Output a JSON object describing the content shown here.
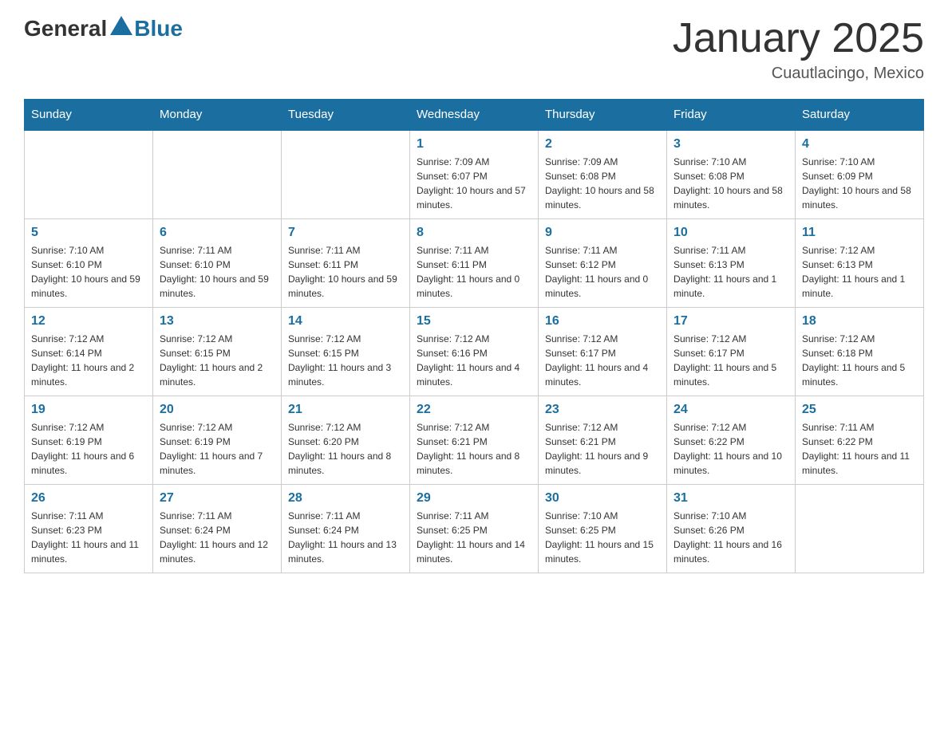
{
  "header": {
    "logo_general": "General",
    "logo_blue": "Blue",
    "month_title": "January 2025",
    "location": "Cuautlacingo, Mexico"
  },
  "weekdays": [
    "Sunday",
    "Monday",
    "Tuesday",
    "Wednesday",
    "Thursday",
    "Friday",
    "Saturday"
  ],
  "weeks": [
    [
      {
        "day": "",
        "info": ""
      },
      {
        "day": "",
        "info": ""
      },
      {
        "day": "",
        "info": ""
      },
      {
        "day": "1",
        "info": "Sunrise: 7:09 AM\nSunset: 6:07 PM\nDaylight: 10 hours and 57 minutes."
      },
      {
        "day": "2",
        "info": "Sunrise: 7:09 AM\nSunset: 6:08 PM\nDaylight: 10 hours and 58 minutes."
      },
      {
        "day": "3",
        "info": "Sunrise: 7:10 AM\nSunset: 6:08 PM\nDaylight: 10 hours and 58 minutes."
      },
      {
        "day": "4",
        "info": "Sunrise: 7:10 AM\nSunset: 6:09 PM\nDaylight: 10 hours and 58 minutes."
      }
    ],
    [
      {
        "day": "5",
        "info": "Sunrise: 7:10 AM\nSunset: 6:10 PM\nDaylight: 10 hours and 59 minutes."
      },
      {
        "day": "6",
        "info": "Sunrise: 7:11 AM\nSunset: 6:10 PM\nDaylight: 10 hours and 59 minutes."
      },
      {
        "day": "7",
        "info": "Sunrise: 7:11 AM\nSunset: 6:11 PM\nDaylight: 10 hours and 59 minutes."
      },
      {
        "day": "8",
        "info": "Sunrise: 7:11 AM\nSunset: 6:11 PM\nDaylight: 11 hours and 0 minutes."
      },
      {
        "day": "9",
        "info": "Sunrise: 7:11 AM\nSunset: 6:12 PM\nDaylight: 11 hours and 0 minutes."
      },
      {
        "day": "10",
        "info": "Sunrise: 7:11 AM\nSunset: 6:13 PM\nDaylight: 11 hours and 1 minute."
      },
      {
        "day": "11",
        "info": "Sunrise: 7:12 AM\nSunset: 6:13 PM\nDaylight: 11 hours and 1 minute."
      }
    ],
    [
      {
        "day": "12",
        "info": "Sunrise: 7:12 AM\nSunset: 6:14 PM\nDaylight: 11 hours and 2 minutes."
      },
      {
        "day": "13",
        "info": "Sunrise: 7:12 AM\nSunset: 6:15 PM\nDaylight: 11 hours and 2 minutes."
      },
      {
        "day": "14",
        "info": "Sunrise: 7:12 AM\nSunset: 6:15 PM\nDaylight: 11 hours and 3 minutes."
      },
      {
        "day": "15",
        "info": "Sunrise: 7:12 AM\nSunset: 6:16 PM\nDaylight: 11 hours and 4 minutes."
      },
      {
        "day": "16",
        "info": "Sunrise: 7:12 AM\nSunset: 6:17 PM\nDaylight: 11 hours and 4 minutes."
      },
      {
        "day": "17",
        "info": "Sunrise: 7:12 AM\nSunset: 6:17 PM\nDaylight: 11 hours and 5 minutes."
      },
      {
        "day": "18",
        "info": "Sunrise: 7:12 AM\nSunset: 6:18 PM\nDaylight: 11 hours and 5 minutes."
      }
    ],
    [
      {
        "day": "19",
        "info": "Sunrise: 7:12 AM\nSunset: 6:19 PM\nDaylight: 11 hours and 6 minutes."
      },
      {
        "day": "20",
        "info": "Sunrise: 7:12 AM\nSunset: 6:19 PM\nDaylight: 11 hours and 7 minutes."
      },
      {
        "day": "21",
        "info": "Sunrise: 7:12 AM\nSunset: 6:20 PM\nDaylight: 11 hours and 8 minutes."
      },
      {
        "day": "22",
        "info": "Sunrise: 7:12 AM\nSunset: 6:21 PM\nDaylight: 11 hours and 8 minutes."
      },
      {
        "day": "23",
        "info": "Sunrise: 7:12 AM\nSunset: 6:21 PM\nDaylight: 11 hours and 9 minutes."
      },
      {
        "day": "24",
        "info": "Sunrise: 7:12 AM\nSunset: 6:22 PM\nDaylight: 11 hours and 10 minutes."
      },
      {
        "day": "25",
        "info": "Sunrise: 7:11 AM\nSunset: 6:22 PM\nDaylight: 11 hours and 11 minutes."
      }
    ],
    [
      {
        "day": "26",
        "info": "Sunrise: 7:11 AM\nSunset: 6:23 PM\nDaylight: 11 hours and 11 minutes."
      },
      {
        "day": "27",
        "info": "Sunrise: 7:11 AM\nSunset: 6:24 PM\nDaylight: 11 hours and 12 minutes."
      },
      {
        "day": "28",
        "info": "Sunrise: 7:11 AM\nSunset: 6:24 PM\nDaylight: 11 hours and 13 minutes."
      },
      {
        "day": "29",
        "info": "Sunrise: 7:11 AM\nSunset: 6:25 PM\nDaylight: 11 hours and 14 minutes."
      },
      {
        "day": "30",
        "info": "Sunrise: 7:10 AM\nSunset: 6:25 PM\nDaylight: 11 hours and 15 minutes."
      },
      {
        "day": "31",
        "info": "Sunrise: 7:10 AM\nSunset: 6:26 PM\nDaylight: 11 hours and 16 minutes."
      },
      {
        "day": "",
        "info": ""
      }
    ]
  ]
}
